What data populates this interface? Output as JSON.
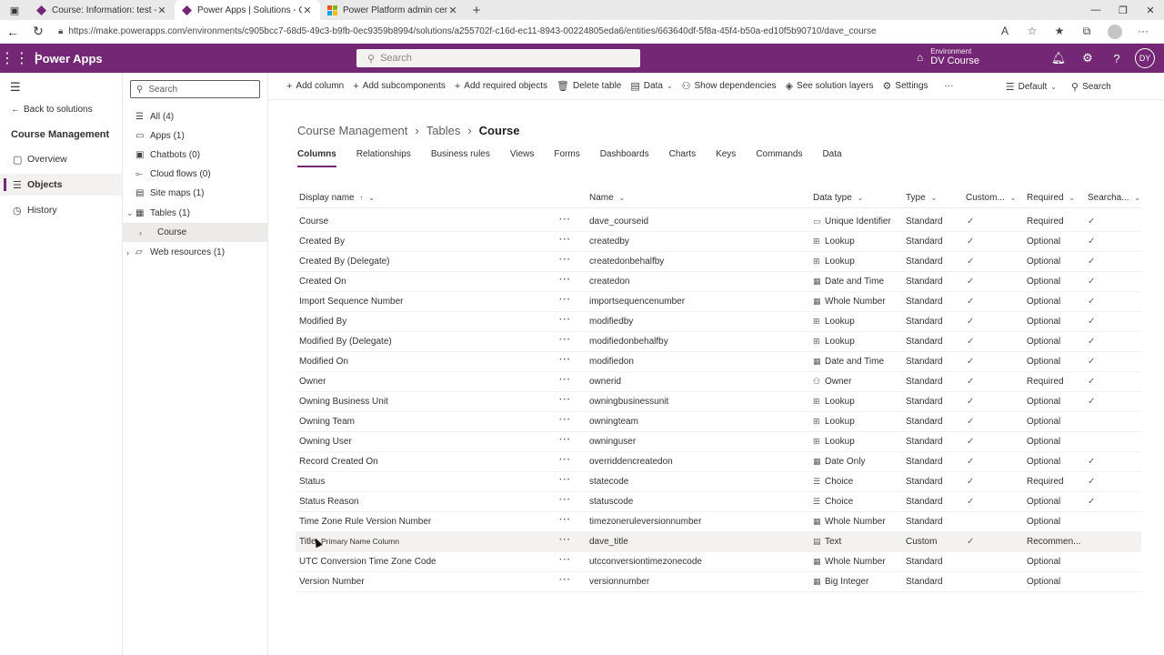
{
  "browser": {
    "tabs": [
      {
        "title": "Course: Information: test - Power",
        "color": "#742774"
      },
      {
        "title": "Power Apps | Solutions - Course",
        "color": "#742774"
      },
      {
        "title": "Power Platform admin center",
        "color": "#f25022"
      }
    ],
    "url": "https://make.powerapps.com/environments/c905bcc7-68d5-49c3-b9fb-0ec9359b8994/solutions/a255702f-c16d-ec11-8943-00224805eda6/entities/663640df-5f8a-45f4-b50a-ed10f5b90710/dave_course"
  },
  "app": {
    "name": "Power Apps",
    "search_placeholder": "Search",
    "environment_label": "Environment",
    "environment_name": "DV Course",
    "user_initials": "DY",
    "accent": "#742774"
  },
  "leftnav": {
    "back": "Back to solutions",
    "solution": "Course Management",
    "items": [
      {
        "label": "Overview",
        "icon": "overview-icon"
      },
      {
        "label": "Objects",
        "icon": "objects-icon"
      },
      {
        "label": "History",
        "icon": "history-icon"
      }
    ]
  },
  "tree": {
    "search_placeholder": "Search",
    "items": [
      {
        "label": "All (4)"
      },
      {
        "label": "Apps (1)"
      },
      {
        "label": "Chatbots (0)"
      },
      {
        "label": "Cloud flows (0)"
      },
      {
        "label": "Site maps (1)"
      },
      {
        "label": "Tables (1)"
      },
      {
        "label": "Course"
      },
      {
        "label": "Web resources (1)"
      }
    ]
  },
  "commands": {
    "add_column": "Add column",
    "add_subcomponents": "Add subcomponents",
    "add_required": "Add required objects",
    "delete_table": "Delete table",
    "data": "Data",
    "show_dependencies": "Show dependencies",
    "see_layers": "See solution layers",
    "settings": "Settings",
    "more": "···",
    "view": "Default",
    "search": "Search"
  },
  "breadcrumb": {
    "solution": "Course Management",
    "tables": "Tables",
    "current": "Course"
  },
  "tabs": [
    "Columns",
    "Relationships",
    "Business rules",
    "Views",
    "Forms",
    "Dashboards",
    "Charts",
    "Keys",
    "Commands",
    "Data"
  ],
  "table": {
    "headers": {
      "display": "Display name",
      "sort": "↑",
      "name": "Name",
      "datatype": "Data type",
      "type": "Type",
      "custom": "Custom...",
      "required": "Required",
      "search": "Searcha..."
    },
    "tooltip": "Primary Name Column",
    "rows": [
      {
        "display": "Course",
        "name": "dave_courseid",
        "datatype": "Unique Identifier",
        "type": "Standard",
        "custom": "✓",
        "required": "Required",
        "search": "✓"
      },
      {
        "display": "Created By",
        "name": "createdby",
        "datatype": "Lookup",
        "type": "Standard",
        "custom": "✓",
        "required": "Optional",
        "search": "✓"
      },
      {
        "display": "Created By (Delegate)",
        "name": "createdonbehalfby",
        "datatype": "Lookup",
        "type": "Standard",
        "custom": "✓",
        "required": "Optional",
        "search": "✓"
      },
      {
        "display": "Created On",
        "name": "createdon",
        "datatype": "Date and Time",
        "type": "Standard",
        "custom": "✓",
        "required": "Optional",
        "search": "✓"
      },
      {
        "display": "Import Sequence Number",
        "name": "importsequencenumber",
        "datatype": "Whole Number",
        "type": "Standard",
        "custom": "✓",
        "required": "Optional",
        "search": "✓"
      },
      {
        "display": "Modified By",
        "name": "modifiedby",
        "datatype": "Lookup",
        "type": "Standard",
        "custom": "✓",
        "required": "Optional",
        "search": "✓"
      },
      {
        "display": "Modified By (Delegate)",
        "name": "modifiedonbehalfby",
        "datatype": "Lookup",
        "type": "Standard",
        "custom": "✓",
        "required": "Optional",
        "search": "✓"
      },
      {
        "display": "Modified On",
        "name": "modifiedon",
        "datatype": "Date and Time",
        "type": "Standard",
        "custom": "✓",
        "required": "Optional",
        "search": "✓"
      },
      {
        "display": "Owner",
        "name": "ownerid",
        "datatype": "Owner",
        "type": "Standard",
        "custom": "✓",
        "required": "Required",
        "search": "✓"
      },
      {
        "display": "Owning Business Unit",
        "name": "owningbusinessunit",
        "datatype": "Lookup",
        "type": "Standard",
        "custom": "✓",
        "required": "Optional",
        "search": "✓"
      },
      {
        "display": "Owning Team",
        "name": "owningteam",
        "datatype": "Lookup",
        "type": "Standard",
        "custom": "✓",
        "required": "Optional",
        "search": ""
      },
      {
        "display": "Owning User",
        "name": "owninguser",
        "datatype": "Lookup",
        "type": "Standard",
        "custom": "✓",
        "required": "Optional",
        "search": ""
      },
      {
        "display": "Record Created On",
        "name": "overriddencreatedon",
        "datatype": "Date Only",
        "type": "Standard",
        "custom": "✓",
        "required": "Optional",
        "search": "✓"
      },
      {
        "display": "Status",
        "name": "statecode",
        "datatype": "Choice",
        "type": "Standard",
        "custom": "✓",
        "required": "Required",
        "search": "✓"
      },
      {
        "display": "Status Reason",
        "name": "statuscode",
        "datatype": "Choice",
        "type": "Standard",
        "custom": "✓",
        "required": "Optional",
        "search": "✓"
      },
      {
        "display": "Time Zone Rule Version Number",
        "name": "timezoneruleversionnumber",
        "datatype": "Whole Number",
        "type": "Standard",
        "custom": "",
        "required": "Optional",
        "search": ""
      },
      {
        "display": "Title",
        "name": "dave_title",
        "datatype": "Text",
        "type": "Custom",
        "custom": "✓",
        "required": "Recommen...",
        "search": ""
      },
      {
        "display": "UTC Conversion Time Zone Code",
        "name": "utcconversiontimezonecode",
        "datatype": "Whole Number",
        "type": "Standard",
        "custom": "",
        "required": "Optional",
        "search": ""
      },
      {
        "display": "Version Number",
        "name": "versionnumber",
        "datatype": "Big Integer",
        "type": "Standard",
        "custom": "",
        "required": "Optional",
        "search": ""
      }
    ]
  }
}
